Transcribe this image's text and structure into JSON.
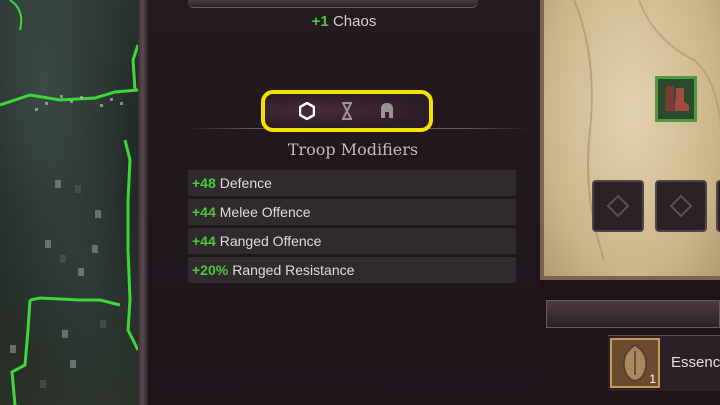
{
  "header": {
    "chaos_value": "+1",
    "chaos_label": "Chaos"
  },
  "tabs": [
    {
      "name": "hexagon-icon",
      "state": "active"
    },
    {
      "name": "hourglass-icon",
      "state": "inactive"
    },
    {
      "name": "helmet-icon",
      "state": "inactive"
    }
  ],
  "section": {
    "title": "Troop Modifiers"
  },
  "modifiers": [
    {
      "value": "+48",
      "label": "Defence"
    },
    {
      "value": "+44",
      "label": "Melee Offence"
    },
    {
      "value": "+44",
      "label": "Ranged Offence"
    },
    {
      "value": "+20%",
      "label": "Ranged Resistance"
    }
  ],
  "equipment": {
    "boots_icon": "boots-icon",
    "empty_slot_icon": "diamond-icon"
  },
  "inventory": {
    "item_icon": "essence-icon",
    "item_count": "1",
    "item_label": "Essenc"
  },
  "colors": {
    "positive": "#4cc83a",
    "highlight": "#f2e400",
    "equipped_border": "#4e9b3c"
  }
}
